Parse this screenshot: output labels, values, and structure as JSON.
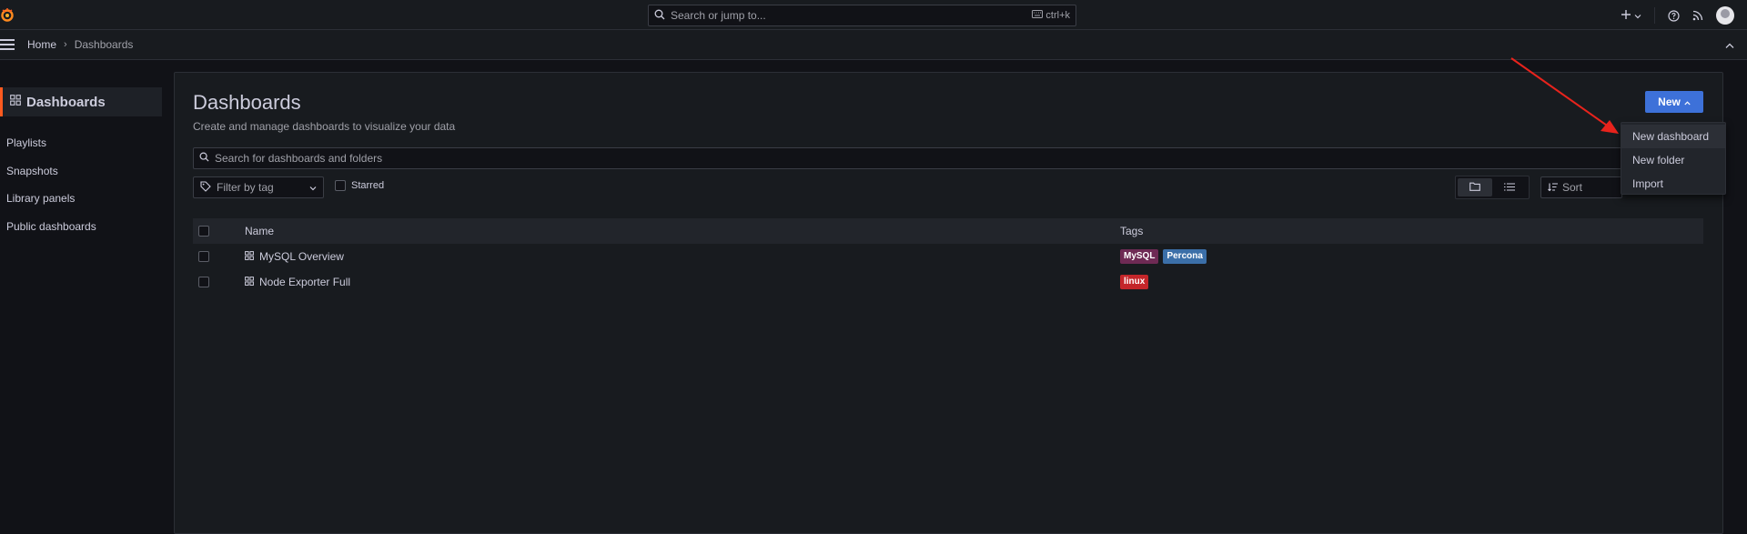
{
  "topbar": {
    "search_placeholder": "Search or jump to...",
    "search_shortcut": "ctrl+k",
    "icons": [
      "grafana-logo-icon",
      "keyboard-icon",
      "plus-icon",
      "help-icon",
      "news-icon",
      "avatar"
    ]
  },
  "breadcrumb": {
    "home": "Home",
    "current": "Dashboards"
  },
  "sidebar": {
    "title": "Dashboards",
    "items": [
      {
        "label": "Playlists"
      },
      {
        "label": "Snapshots"
      },
      {
        "label": "Library panels"
      },
      {
        "label": "Public dashboards"
      }
    ]
  },
  "page": {
    "title": "Dashboards",
    "subtitle": "Create and manage dashboards to visualize your data",
    "new_button": "New",
    "search_placeholder": "Search for dashboards and folders",
    "filter_tag_placeholder": "Filter by tag",
    "starred_label": "Starred",
    "sort_label": "Sort"
  },
  "table": {
    "headers": {
      "name": "Name",
      "tags": "Tags"
    },
    "rows": [
      {
        "name": "MySQL Overview",
        "tags": [
          {
            "label": "MySQL",
            "color": "#6e2a54"
          },
          {
            "label": "Percona",
            "color": "#3b6fa8"
          }
        ]
      },
      {
        "name": "Node Exporter Full",
        "tags": [
          {
            "label": "linux",
            "color": "#c4262a"
          }
        ]
      }
    ]
  },
  "new_menu": {
    "items": [
      {
        "label": "New dashboard"
      },
      {
        "label": "New folder"
      },
      {
        "label": "Import"
      }
    ]
  },
  "colors": {
    "accent": "#3d71d9",
    "brand": "#ff5a1f",
    "annotation_arrow": "#e8231c"
  }
}
